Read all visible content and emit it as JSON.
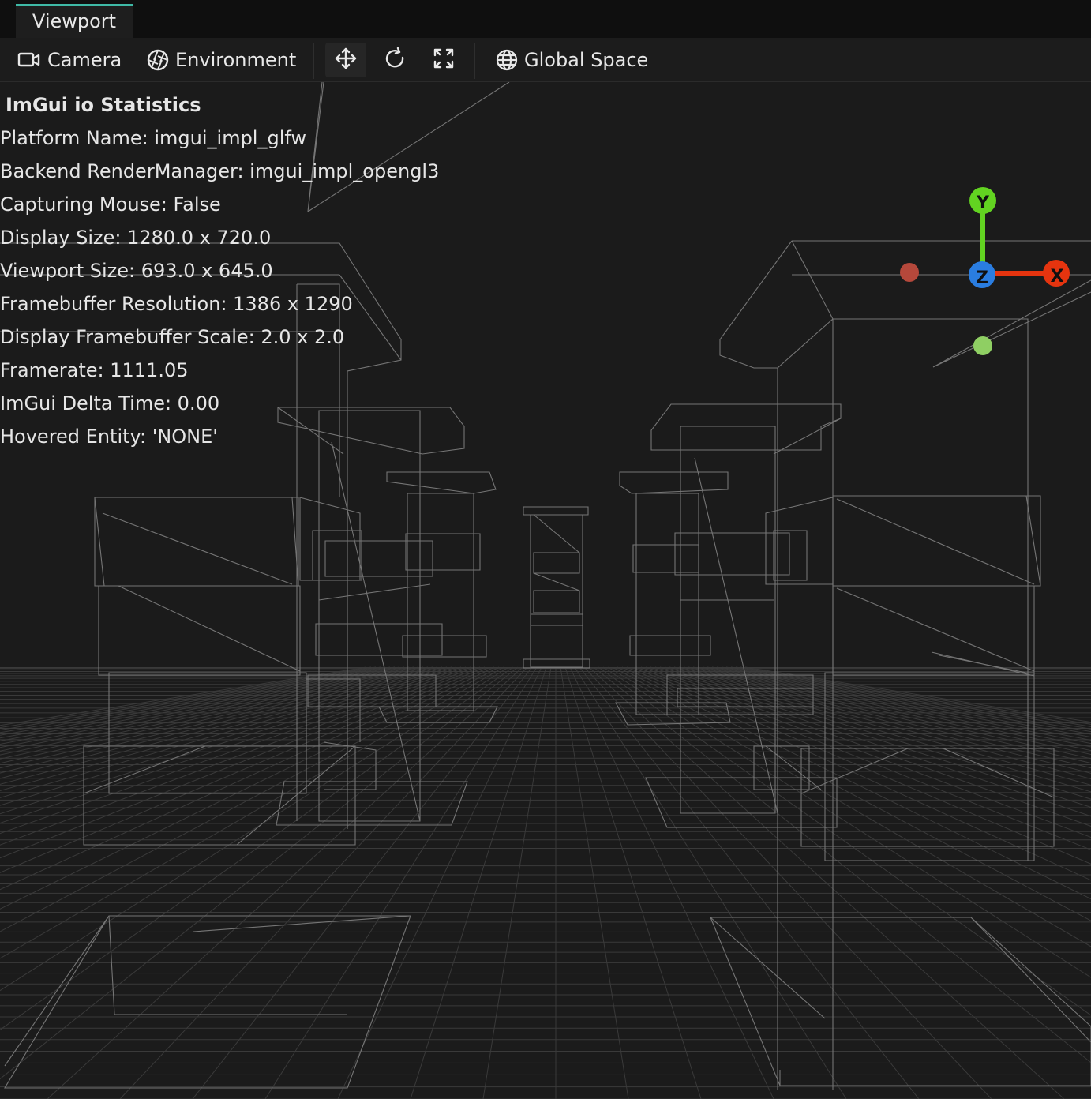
{
  "window": {
    "tab_label": "Viewport"
  },
  "toolbar": {
    "camera_label": "Camera",
    "camera_icon": "video-camera-icon",
    "environment_label": "Environment",
    "environment_icon": "aperture-icon",
    "move_icon": "move-arrows-icon",
    "rotate_icon": "rotate-icon",
    "scale_icon": "expand-corners-icon",
    "space_label": "Global Space",
    "space_icon": "globe-icon"
  },
  "stats": {
    "title": "ImGui io Statistics",
    "lines": [
      "Platform Name: imgui_impl_glfw",
      "Backend RenderManager: imgui_impl_opengl3",
      "Capturing Mouse: False",
      "Display Size: 1280.0 x 720.0",
      "Viewport Size: 693.0 x 645.0",
      "Framebuffer Resolution: 1386 x 1290",
      "Display Framebuffer Scale: 2.0 x 2.0",
      "Framerate: 1111.05",
      "ImGui Delta Time: 0.00",
      "Hovered Entity: 'NONE'"
    ]
  },
  "gizmo": {
    "y_label": "Y",
    "x_label": "X",
    "z_label": "Z",
    "y_color": "#62d321",
    "x_color": "#e5340f",
    "z_color": "#2a7de1",
    "neg_x_color": "#b5483b",
    "neg_y_color": "#8fcf63"
  },
  "colors": {
    "accent": "#3fb9a6",
    "background": "#1b1b1b",
    "wireframe": "#7a7a7a",
    "grid": "#3a3a3a"
  }
}
